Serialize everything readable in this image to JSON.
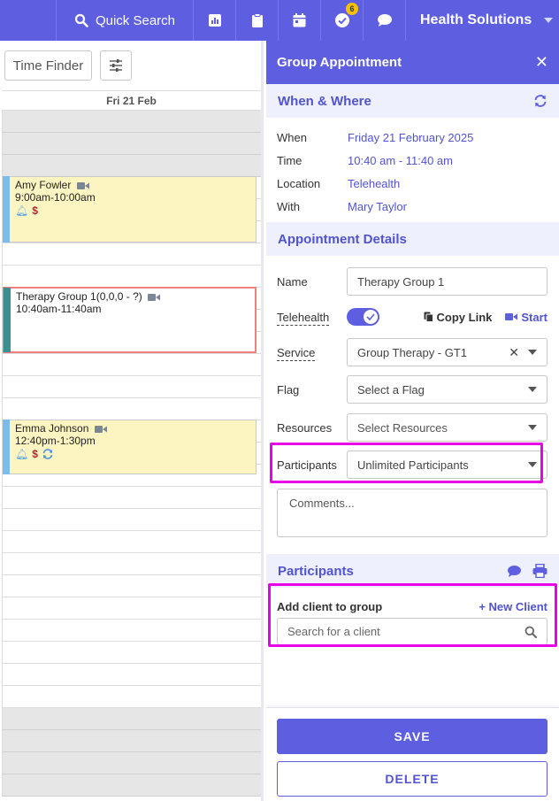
{
  "topbar": {
    "search_label": "Quick Search",
    "badge_count": "6",
    "org_name": "Health Solutions",
    "icons": [
      "search-icon",
      "reports-icon",
      "clipboard-icon",
      "calendar-icon",
      "tasks-icon",
      "chat-icon"
    ]
  },
  "calendar": {
    "time_finder_label": "Time Finder",
    "day_label": "Fri 21 Feb",
    "appointments": [
      {
        "title": "Amy Fowler",
        "time": "9:00am-10:00am"
      },
      {
        "title": "Therapy Group 1(0,0,0 - ?)",
        "time": "10:40am-11:40am"
      },
      {
        "title": "Emma Johnson",
        "time": "12:40pm-1:30pm"
      }
    ]
  },
  "panel": {
    "title": "Group Appointment",
    "when_where": {
      "heading": "When & Where",
      "when_label": "When",
      "when_value": "Friday 21 February 2025",
      "time_label": "Time",
      "time_value": "10:40 am - 11:40 am",
      "location_label": "Location",
      "location_value": "Telehealth",
      "with_label": "With",
      "with_value": "Mary Taylor"
    },
    "details": {
      "heading": "Appointment Details",
      "name_label": "Name",
      "name_value": "Therapy Group 1",
      "telehealth_label": "Telehealth",
      "telehealth_on": true,
      "copy_link_label": "Copy Link",
      "start_label": "Start",
      "service_label": "Service",
      "service_value": "Group Therapy - GT1",
      "flag_label": "Flag",
      "flag_placeholder": "Select a Flag",
      "resources_label": "Resources",
      "resources_placeholder": "Select Resources",
      "participants_label": "Participants",
      "participants_value": "Unlimited Participants",
      "comments_placeholder": "Comments..."
    },
    "participants": {
      "heading": "Participants",
      "add_label": "Add client to group",
      "new_client_label": "+ New Client",
      "search_placeholder": "Search for a client"
    },
    "save_label": "SAVE",
    "delete_label": "DELETE"
  }
}
